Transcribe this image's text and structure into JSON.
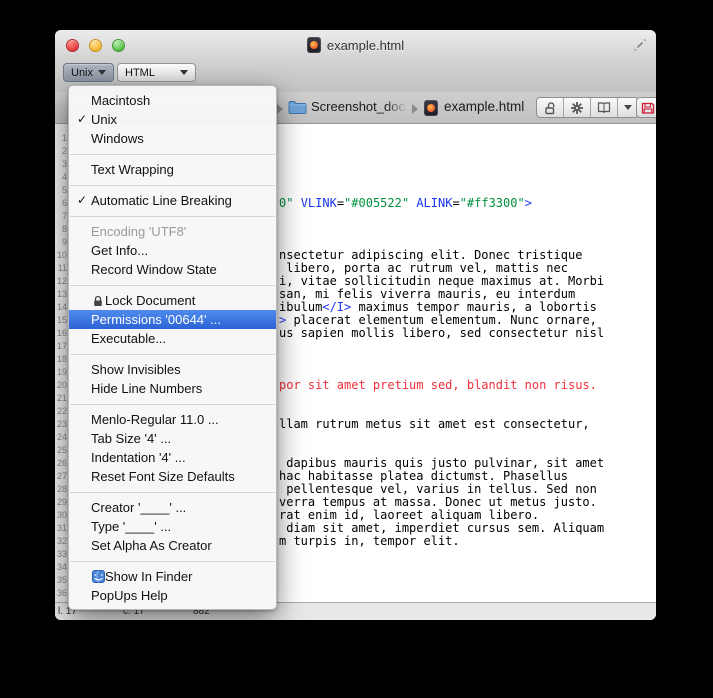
{
  "window": {
    "title": "example.html",
    "traffic_lights": [
      "close",
      "minimize",
      "zoom"
    ]
  },
  "toolbar": {
    "line_ending_popup": "Unix",
    "language_popup": "HTML"
  },
  "navbar": {
    "folder": "Screenshot_docs",
    "file": "example.html",
    "buttons": [
      "unlock-icon",
      "gear-icon",
      "bookmarks-icon",
      "dropdown-icon",
      "save-icon"
    ]
  },
  "menu": {
    "items": [
      {
        "label": "Macintosh"
      },
      {
        "label": "Unix",
        "checked": true
      },
      {
        "label": "Windows"
      },
      {
        "separator": true
      },
      {
        "label": "Text Wrapping"
      },
      {
        "separator": true
      },
      {
        "label": "Automatic Line Breaking",
        "checked": true
      },
      {
        "separator": true
      },
      {
        "label": "Encoding 'UTF8'",
        "disabled": true
      },
      {
        "label": "Get Info..."
      },
      {
        "label": "Record Window State"
      },
      {
        "separator": true
      },
      {
        "label": "Lock Document",
        "icon": "lock"
      },
      {
        "label": "Permissions '00644' ...",
        "highlighted": true
      },
      {
        "label": "Executable..."
      },
      {
        "separator": true
      },
      {
        "label": "Show Invisibles"
      },
      {
        "label": "Hide Line Numbers"
      },
      {
        "separator": true
      },
      {
        "label": "Menlo-Regular 11.0 ..."
      },
      {
        "label": "Tab Size '4' ..."
      },
      {
        "label": "Indentation '4' ..."
      },
      {
        "label": "Reset Font Size Defaults"
      },
      {
        "separator": true
      },
      {
        "label": "Creator '____' ..."
      },
      {
        "label": "Type '____' ..."
      },
      {
        "label": "Set Alpha As Creator"
      },
      {
        "separator": true
      },
      {
        "label": "Show In Finder",
        "icon": "finder"
      },
      {
        "label": "PopUps Help"
      }
    ]
  },
  "editor": {
    "visible_line_numbers": 37,
    "lines": [
      {
        "n": 6,
        "segments": [
          [
            "0\"",
            "attr_val"
          ],
          [
            " ",
            "plain"
          ],
          [
            "VLINK",
            "tag"
          ],
          [
            "=",
            "plain"
          ],
          [
            "\"#005522\"",
            "attr_val"
          ],
          [
            " ",
            "plain"
          ],
          [
            "ALINK",
            "tag"
          ],
          [
            "=",
            "plain"
          ],
          [
            "\"#ff3300\"",
            "attr_val"
          ],
          [
            ">",
            "tag"
          ]
        ]
      },
      {
        "n": 10,
        "segments": [
          [
            "nsectetur adipiscing elit. Donec tristique",
            "plain"
          ]
        ]
      },
      {
        "n": 11,
        "segments": [
          [
            " libero, porta ac rutrum vel, mattis nec",
            "plain"
          ]
        ]
      },
      {
        "n": 12,
        "segments": [
          [
            "i, vitae sollicitudin neque maximus at. Morbi",
            "plain"
          ]
        ]
      },
      {
        "n": 13,
        "segments": [
          [
            "san, mi felis viverra mauris, eu interdum",
            "plain"
          ]
        ]
      },
      {
        "n": 14,
        "segments": [
          [
            "ibulum",
            "plain"
          ],
          [
            "</I>",
            "tag"
          ],
          [
            " maximus tempor mauris, a lobortis",
            "plain"
          ]
        ]
      },
      {
        "n": 15,
        "segments": [
          [
            ">",
            "tag"
          ],
          [
            " placerat elementum elementum. Nunc ornare,",
            "plain"
          ]
        ]
      },
      {
        "n": 16,
        "segments": [
          [
            "us sapien mollis libero, sed consectetur nisl",
            "plain"
          ]
        ]
      },
      {
        "n": 20,
        "segments": [
          [
            "por sit amet pretium sed, blandit non risus.",
            "error"
          ]
        ]
      },
      {
        "n": 23,
        "segments": [
          [
            "llam rutrum metus sit amet est consectetur,",
            "plain"
          ]
        ]
      },
      {
        "n": 26,
        "segments": [
          [
            " dapibus mauris quis justo pulvinar, sit amet",
            "plain"
          ]
        ]
      },
      {
        "n": 27,
        "segments": [
          [
            "hac habitasse platea dictumst. Phasellus",
            "plain"
          ]
        ]
      },
      {
        "n": 28,
        "segments": [
          [
            " pellentesque vel, varius in tellus. Sed non",
            "plain"
          ]
        ]
      },
      {
        "n": 29,
        "segments": [
          [
            "verra tempus at massa. Donec ut metus justo.",
            "plain"
          ]
        ]
      },
      {
        "n": 30,
        "segments": [
          [
            "rat enim id, laoreet aliquam libero.",
            "plain"
          ]
        ]
      },
      {
        "n": 31,
        "segments": [
          [
            " diam sit amet, imperdiet cursus sem. Aliquam",
            "plain"
          ]
        ]
      },
      {
        "n": 32,
        "segments": [
          [
            "m turpis in, tempor elit.",
            "plain"
          ]
        ]
      }
    ]
  },
  "statusbar": {
    "line": "l. 17",
    "column": "c. 17",
    "chars": "882"
  },
  "colors": {
    "menu_highlight": "#3875d7",
    "syntax_tag": "#1b35f0",
    "syntax_value": "#009140",
    "syntax_error": "#f2303d",
    "save_icon_red": "#cc2233"
  }
}
